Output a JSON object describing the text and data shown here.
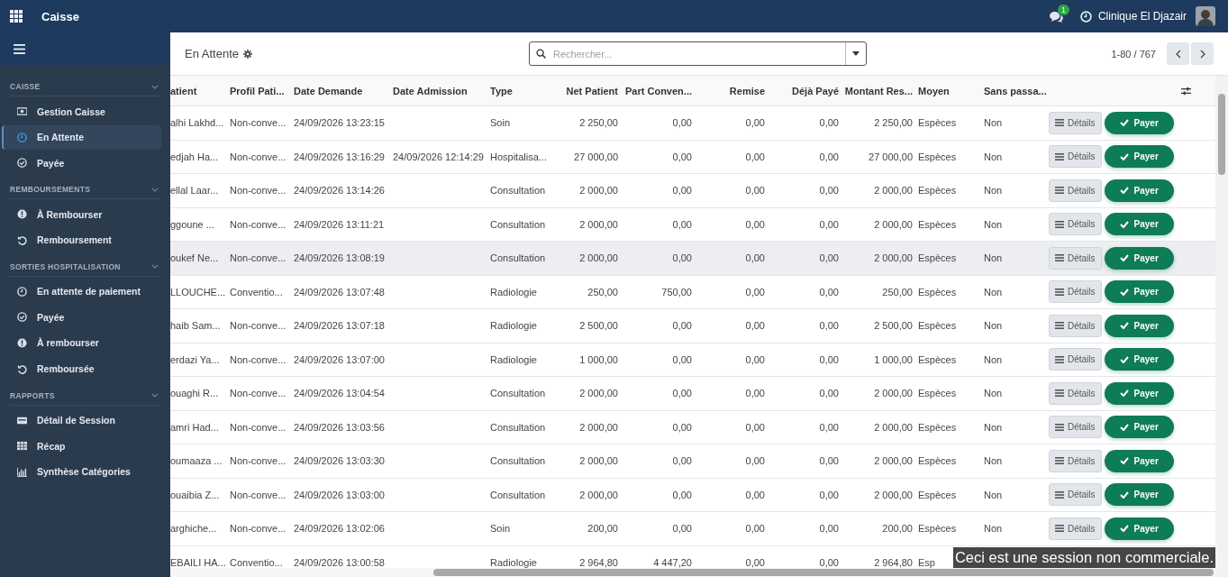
{
  "topbar": {
    "app_title": "Caisse",
    "messages_badge": "1",
    "company": "Clinique El Djazair"
  },
  "sidebar": {
    "sections": [
      {
        "title": "CAISSE",
        "expanded": true,
        "items": [
          {
            "label": "Gestion Caisse",
            "selected": false
          },
          {
            "label": "En Attente",
            "selected": true
          },
          {
            "label": "Payée",
            "selected": false
          }
        ]
      },
      {
        "title": "REMBOURSEMENTS",
        "expanded": true,
        "items": [
          {
            "label": "À Rembourser",
            "selected": false
          },
          {
            "label": "Remboursement",
            "selected": false
          }
        ]
      },
      {
        "title": "SORTIES HOSPITALISATION",
        "expanded": true,
        "items": [
          {
            "label": "En attente de paiement",
            "selected": false
          },
          {
            "label": "Payée",
            "selected": false
          },
          {
            "label": "À rembourser",
            "selected": false
          },
          {
            "label": "Remboursée",
            "selected": false
          }
        ]
      },
      {
        "title": "RAPPORTS",
        "expanded": true,
        "items": [
          {
            "label": "Détail de Session",
            "selected": false
          },
          {
            "label": "Récap",
            "selected": false
          },
          {
            "label": "Synthèse Catégories",
            "selected": false
          }
        ]
      }
    ]
  },
  "control_panel": {
    "title": "En Attente",
    "search": {
      "placeholder": "Rechercher..."
    },
    "pager": "1-80 / 767"
  },
  "table": {
    "columns": [
      {
        "label": "atient",
        "kind": "text"
      },
      {
        "label": "Profil Pati...",
        "kind": "text"
      },
      {
        "label": "Date Demande",
        "kind": "text"
      },
      {
        "label": "Date Admission",
        "kind": "text"
      },
      {
        "label": "Type",
        "kind": "text"
      },
      {
        "label": "Net Patient",
        "kind": "number"
      },
      {
        "label": "Part Conven...",
        "kind": "number"
      },
      {
        "label": "Remise",
        "kind": "number"
      },
      {
        "label": "Déjà Payé",
        "kind": "number"
      },
      {
        "label": "Montant Res...",
        "kind": "number"
      },
      {
        "label": "Moyen",
        "kind": "text"
      },
      {
        "label": "Sans passa...",
        "kind": "text"
      }
    ],
    "rows": [
      {
        "highlighted": false,
        "details_label": "Détails",
        "pay_label": "Payer",
        "cells": [
          "alhi Lakhd...",
          "Non-conve...",
          "24/09/2026 13:23:15",
          "",
          "Soin",
          "2 250,00",
          "0,00",
          "0,00",
          "0,00",
          "2 250,00",
          "Espèces",
          "Non"
        ]
      },
      {
        "highlighted": false,
        "details_label": "Détails",
        "pay_label": "Payer",
        "cells": [
          "edjah Ha...",
          "Non-conve...",
          "24/09/2026 13:16:29",
          "24/09/2026 12:14:29",
          "Hospitalisa...",
          "27 000,00",
          "0,00",
          "0,00",
          "0,00",
          "27 000,00",
          "Espèces",
          "Non"
        ]
      },
      {
        "highlighted": false,
        "details_label": "Détails",
        "pay_label": "Payer",
        "cells": [
          "ellal Laar...",
          "Non-conve...",
          "24/09/2026 13:14:26",
          "",
          "Consultation",
          "2 000,00",
          "0,00",
          "0,00",
          "0,00",
          "2 000,00",
          "Espèces",
          "Non"
        ]
      },
      {
        "highlighted": false,
        "details_label": "Détails",
        "pay_label": "Payer",
        "cells": [
          "ggoune ...",
          "Non-conve...",
          "24/09/2026 13:11:21",
          "",
          "Consultation",
          "2 000,00",
          "0,00",
          "0,00",
          "0,00",
          "2 000,00",
          "Espèces",
          "Non"
        ]
      },
      {
        "highlighted": true,
        "details_label": "Détails",
        "pay_label": "Payer",
        "cells": [
          "oukef Ne...",
          "Non-conve...",
          "24/09/2026 13:08:19",
          "",
          "Consultation",
          "2 000,00",
          "0,00",
          "0,00",
          "0,00",
          "2 000,00",
          "Espèces",
          "Non"
        ]
      },
      {
        "highlighted": false,
        "details_label": "Détails",
        "pay_label": "Payer",
        "cells": [
          "LLOUCHE...",
          "Conventio...",
          "24/09/2026 13:07:48",
          "",
          "Radiologie",
          "250,00",
          "750,00",
          "0,00",
          "0,00",
          "250,00",
          "Espèces",
          "Non"
        ]
      },
      {
        "highlighted": false,
        "details_label": "Détails",
        "pay_label": "Payer",
        "cells": [
          "haib Sam...",
          "Non-conve...",
          "24/09/2026 13:07:18",
          "",
          "Radiologie",
          "2 500,00",
          "0,00",
          "0,00",
          "0,00",
          "2 500,00",
          "Espèces",
          "Non"
        ]
      },
      {
        "highlighted": false,
        "details_label": "Détails",
        "pay_label": "Payer",
        "cells": [
          "erdazi Ya...",
          "Non-conve...",
          "24/09/2026 13:07:00",
          "",
          "Radiologie",
          "1 000,00",
          "0,00",
          "0,00",
          "0,00",
          "1 000,00",
          "Espèces",
          "Non"
        ]
      },
      {
        "highlighted": false,
        "details_label": "Détails",
        "pay_label": "Payer",
        "cells": [
          "ouaghi R...",
          "Non-conve...",
          "24/09/2026 13:04:54",
          "",
          "Consultation",
          "2 000,00",
          "0,00",
          "0,00",
          "0,00",
          "2 000,00",
          "Espèces",
          "Non"
        ]
      },
      {
        "highlighted": false,
        "details_label": "Détails",
        "pay_label": "Payer",
        "cells": [
          "amri Had...",
          "Non-conve...",
          "24/09/2026 13:03:56",
          "",
          "Consultation",
          "2 000,00",
          "0,00",
          "0,00",
          "0,00",
          "2 000,00",
          "Espèces",
          "Non"
        ]
      },
      {
        "highlighted": false,
        "details_label": "Détails",
        "pay_label": "Payer",
        "cells": [
          "oumaaza ...",
          "Non-conve...",
          "24/09/2026 13:03:30",
          "",
          "Consultation",
          "2 000,00",
          "0,00",
          "0,00",
          "0,00",
          "2 000,00",
          "Espèces",
          "Non"
        ]
      },
      {
        "highlighted": false,
        "details_label": "Détails",
        "pay_label": "Payer",
        "cells": [
          "ouaibia Z...",
          "Non-conve...",
          "24/09/2026 13:03:00",
          "",
          "Consultation",
          "2 000,00",
          "0,00",
          "0,00",
          "0,00",
          "2 000,00",
          "Espèces",
          "Non"
        ]
      },
      {
        "highlighted": false,
        "details_label": "Détails",
        "pay_label": "Payer",
        "cells": [
          "arghiche...",
          "Non-conve...",
          "24/09/2026 13:02:06",
          "",
          "Soin",
          "200,00",
          "0,00",
          "0,00",
          "0,00",
          "200,00",
          "Espèces",
          "Non"
        ]
      },
      {
        "highlighted": false,
        "cells": [
          "EBAILI HA...",
          "Conventio...",
          "24/09/2026 13:00:58",
          "",
          "Radiologie",
          "2 964,80",
          "4 447,20",
          "0,00",
          "0,00",
          "2 964,80",
          "Esp",
          ""
        ]
      }
    ]
  },
  "session_notice": "Ceci est une session non commerciale."
}
